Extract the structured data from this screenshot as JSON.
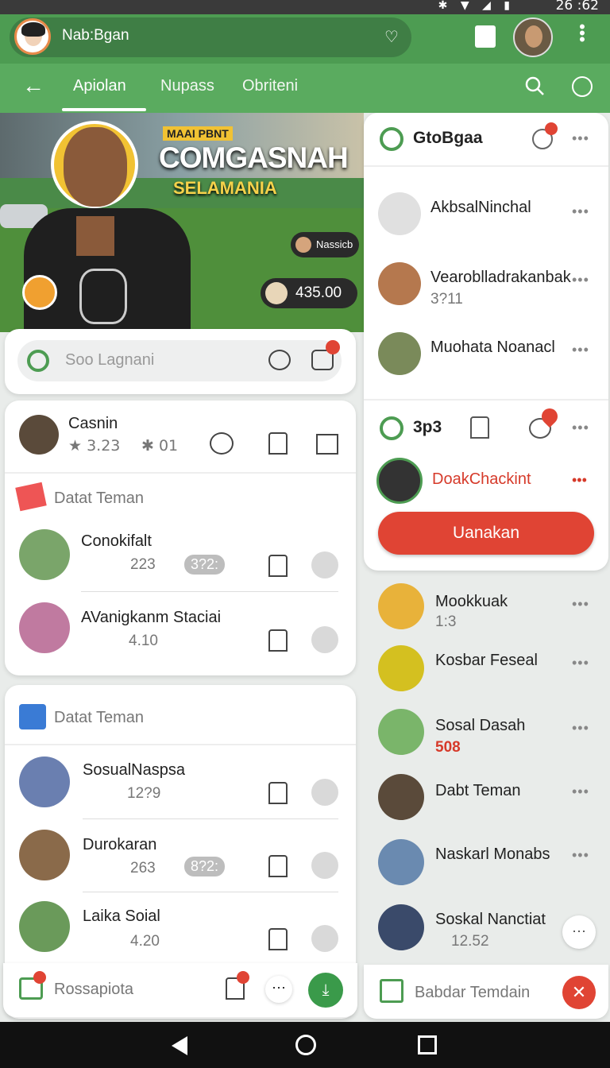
{
  "status": {
    "time": "26 :62"
  },
  "header": {
    "title": "Nab:Bgan"
  },
  "tabs": [
    "Apiolan",
    "Nupass",
    "Obriteni"
  ],
  "hero": {
    "tag": "MAAI PBNT",
    "title": "COMGASNAH",
    "subtitle": "SELAMANIA",
    "user_chip": "Nassicb",
    "amount": "435.00"
  },
  "search": {
    "placeholder": "Soo Lagnani"
  },
  "profile_card": {
    "name": "Casnin",
    "stat1": "3.23",
    "stat2": "01"
  },
  "friends_section1": {
    "title": "Datat Teman",
    "items": [
      {
        "name": "Conokifalt",
        "count": "223",
        "badge": "3?2:"
      },
      {
        "name": "AVanigkanm Staciai",
        "count": "4.10"
      }
    ]
  },
  "friends_section2": {
    "title": "Datat Teman",
    "items": [
      {
        "name": "SosualNaspsa",
        "count": "12?9"
      },
      {
        "name": "Durokaran",
        "count": "263",
        "badge": "8?2:"
      },
      {
        "name": "Laika Soial",
        "count": "4.20"
      }
    ]
  },
  "bottom_left": {
    "label": "Rossapiota"
  },
  "right_panel": {
    "title": "GtoBgaa",
    "contacts": [
      {
        "name": "AkbsalNinchal"
      },
      {
        "name": "Vearoblladrakanbak",
        "sub": "3?11"
      },
      {
        "name": "Muohata Noanacl"
      }
    ],
    "section2_title": "3p3",
    "featured_name": "DoakChackint",
    "action_button": "Uanakan"
  },
  "right_list": [
    {
      "name": "Mookkuak",
      "sub": "1:3"
    },
    {
      "name": "Kosbar Feseal"
    },
    {
      "name": "Sosal Dasah",
      "sub": "508"
    },
    {
      "name": "Dabt Teman"
    },
    {
      "name": "Naskarl Monabs"
    },
    {
      "name": "Soskal Nanctiat",
      "sub": "12.52"
    }
  ],
  "bottom_right": {
    "label": "Babdar Temdain"
  },
  "colors": {
    "primary": "#4d9c52",
    "accent_red": "#e04434",
    "header_dark": "#3f7e45"
  }
}
